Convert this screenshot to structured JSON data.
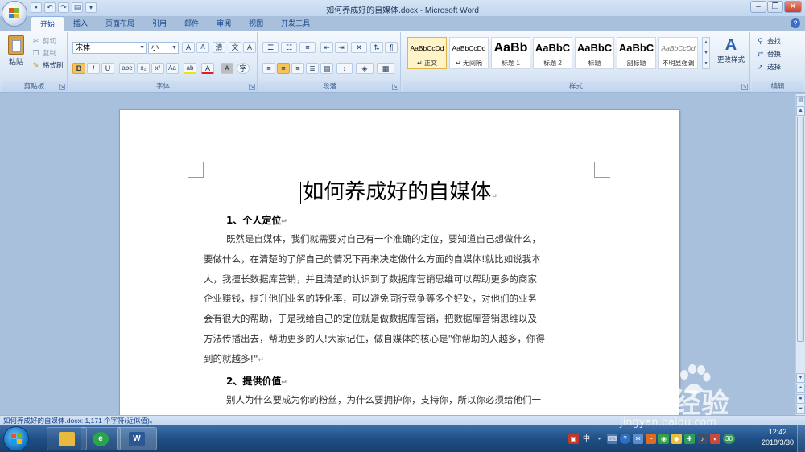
{
  "window": {
    "title": "如何养成好的自媒体.docx - Microsoft Word",
    "controls": [
      "minimize",
      "maximize",
      "close"
    ]
  },
  "quick_access": [
    "save-icon",
    "undo-icon",
    "redo-icon",
    "print-preview-icon"
  ],
  "tabs": [
    {
      "label": "开始",
      "active": true
    },
    {
      "label": "插入"
    },
    {
      "label": "页面布局"
    },
    {
      "label": "引用"
    },
    {
      "label": "邮件"
    },
    {
      "label": "审阅"
    },
    {
      "label": "视图"
    },
    {
      "label": "开发工具"
    }
  ],
  "ribbon": {
    "clipboard": {
      "label": "剪贴板",
      "paste": "粘贴",
      "cut": "剪切",
      "copy": "复制",
      "format_painter": "格式刷"
    },
    "font": {
      "label": "字体",
      "font_name": "宋体",
      "font_size": "小一",
      "grow": "A",
      "shrink": "A",
      "clear": "清",
      "phonetic": "文",
      "border": "A",
      "bold": "B",
      "italic": "I",
      "underline": "U",
      "strike": "abe",
      "subscript": "x₂",
      "superscript": "x²",
      "case": "Aa",
      "highlight": "ab",
      "font_color": "A",
      "shading": "A",
      "enclose": "字"
    },
    "paragraph": {
      "label": "段落"
    },
    "styles": {
      "label": "样式",
      "items": [
        {
          "preview": "AaBbCcDd",
          "name": "↵ 正文",
          "active": true
        },
        {
          "preview": "AaBbCcDd",
          "name": "↵ 无间隔"
        },
        {
          "preview": "AaBb",
          "name": "标题 1"
        },
        {
          "preview": "AaBbC",
          "name": "标题 2"
        },
        {
          "preview": "AaBbC",
          "name": "标题"
        },
        {
          "preview": "AaBbC",
          "name": "副标题"
        },
        {
          "preview": "AaBbCcDd",
          "name": "不明显强调"
        }
      ],
      "change_styles": "更改样式"
    },
    "editing": {
      "label": "编辑",
      "find": "查找",
      "replace": "替换",
      "select": "选择"
    }
  },
  "document": {
    "title": "如何养成好的自媒体",
    "mark": "↵",
    "sections": [
      {
        "heading": "1、个人定位",
        "lines": [
          "既然是自媒体，我们就需要对自己有一个准确的定位，要知道自己想做什么，",
          "要做什么，在清楚的了解自己的情况下再来决定做什么方面的自媒体!就比如说我本",
          "人，我擅长数据库营销，并且清楚的认识到了数据库营销思维可以帮助更多的商家",
          "企业赚钱，提升他们业务的转化率，可以避免同行竞争等多个好处，对他们的业务",
          "会有很大的帮助，于是我给自己的定位就是做数据库营销，把数据库营销思维以及",
          "方法传播出去，帮助更多的人!大家记住，做自媒体的核心是\"你帮助的人越多，你得",
          "到的就越多!\""
        ]
      },
      {
        "heading": "2、提供价值",
        "lines": [
          "别人为什么要成为你的粉丝，为什么要拥护你，支持你，所以你必须给他们一"
        ]
      }
    ]
  },
  "statusbar": {
    "text": "如何养成好的自媒体.docx: 1,171 个字符(近似值)。"
  },
  "taskbar": {
    "apps": [
      "windows-explorer",
      "internet-explorer",
      "microsoft-word"
    ],
    "ime": "中",
    "battery_badge": "30",
    "time": "12:42",
    "date": "2018/3/30"
  },
  "watermark": {
    "brand": "Bai 经验",
    "url": "jingyan.baidu.com"
  },
  "colors": {
    "ribbon_bg": "#dbe7f5",
    "doc_bg": "#a8c0dc",
    "taskbar": "#1f4f86",
    "active_style": "#fff3c8"
  }
}
